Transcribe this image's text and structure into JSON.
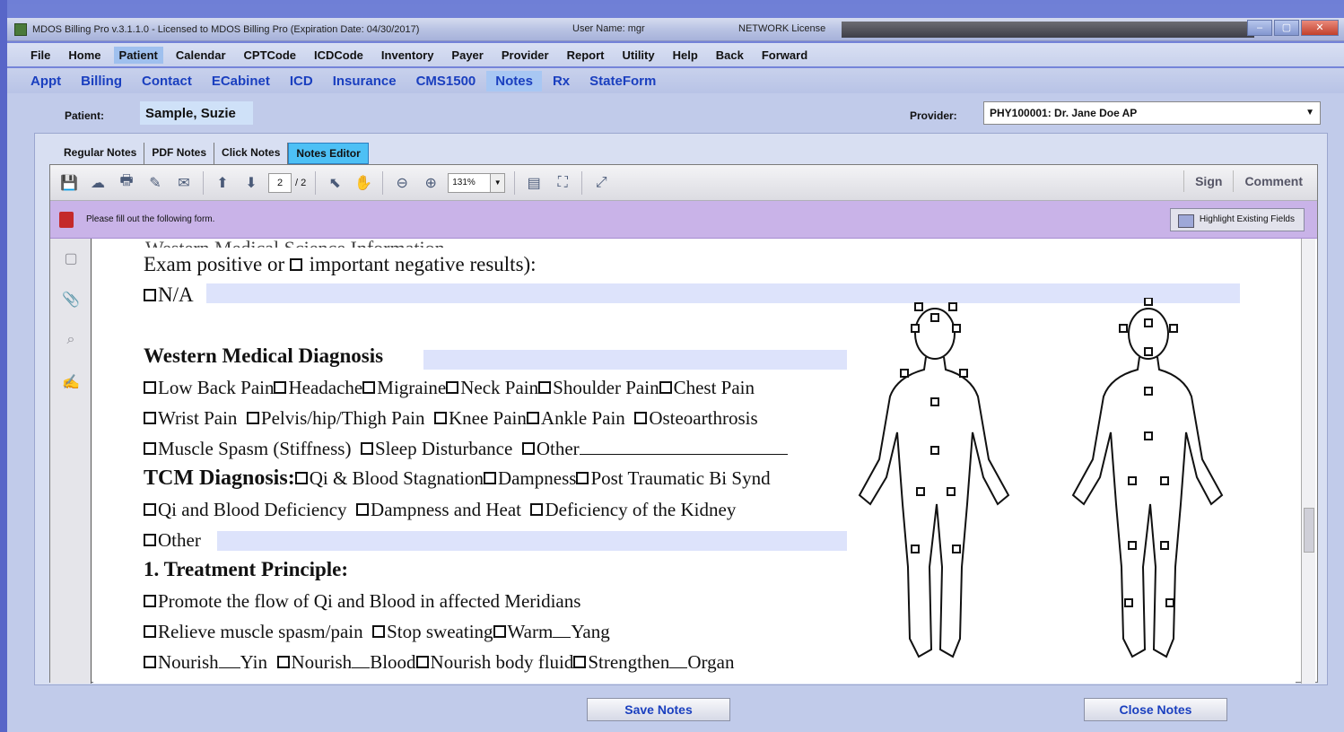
{
  "window": {
    "title": "MDOS Billing Pro v.3.1.1.0 - Licensed to MDOS Billing Pro (Expiration Date: 04/30/2017)",
    "user": "User Name: mgr",
    "license": "NETWORK License"
  },
  "menu": [
    "File",
    "Home",
    "Patient",
    "Calendar",
    "CPTCode",
    "ICDCode",
    "Inventory",
    "Payer",
    "Provider",
    "Report",
    "Utility",
    "Help",
    "Back",
    "Forward"
  ],
  "submenu": [
    "Appt",
    "Billing",
    "Contact",
    "ECabinet",
    "ICD",
    "Insurance",
    "CMS1500",
    "Notes",
    "Rx",
    "StateForm"
  ],
  "patient": {
    "label": "Patient:",
    "value": "Sample, Suzie"
  },
  "provider": {
    "label": "Provider:",
    "value": "PHY100001: Dr. Jane Doe AP"
  },
  "tabs": [
    "Regular Notes",
    "PDF Notes",
    "Click Notes",
    "Notes Editor"
  ],
  "toolbar": {
    "page_current": "2",
    "page_total": "/ 2",
    "zoom": "131%",
    "sign": "Sign",
    "comment": "Comment"
  },
  "formbar": {
    "message": "Please fill out the following form.",
    "highlight": "Highlight Existing Fields"
  },
  "doc": {
    "l1": "Exam positive or",
    "l1b": "important negative results):",
    "na": "N/A",
    "wmd_title": "Western Medical Diagnosis",
    "r1": [
      "Low Back Pain",
      "Headache",
      "Migraine",
      "Neck Pain",
      "Shoulder Pain",
      "Chest Pain"
    ],
    "r2": [
      "Wrist Pain",
      "Pelvis/hip/Thigh Pain",
      "Knee Pain",
      "Ankle Pain",
      "Osteoarthrosis"
    ],
    "r3": [
      "Muscle Spasm (Stiffness)",
      "Sleep Disturbance",
      "Other"
    ],
    "tcm_title": "TCM Diagnosis:",
    "r4": [
      "Qi & Blood Stagnation",
      "Dampness",
      "Post Traumatic Bi Synd"
    ],
    "r5": [
      "Qi and Blood Deficiency",
      "Dampness and Heat",
      "Deficiency of the Kidney"
    ],
    "other": "Other",
    "tp_title": "1.   Treatment Principle:",
    "r6": "Promote the flow of Qi and Blood in affected Meridians",
    "r7": [
      "Relieve muscle spasm/pain",
      "Stop sweating",
      "Warm",
      "Yang"
    ],
    "r8": [
      "Nourish",
      "Yin",
      "Nourish",
      "Blood",
      "Nourish body fluid",
      "Strengthen",
      "Organ"
    ]
  },
  "buttons": {
    "save": "Save Notes",
    "close": "Close Notes"
  },
  "colors": {
    "background": "#7c89dc",
    "active_tab": "#4dc0f5",
    "form_bar": "#c9b3e8",
    "link_blue": "#1a3fbf"
  }
}
